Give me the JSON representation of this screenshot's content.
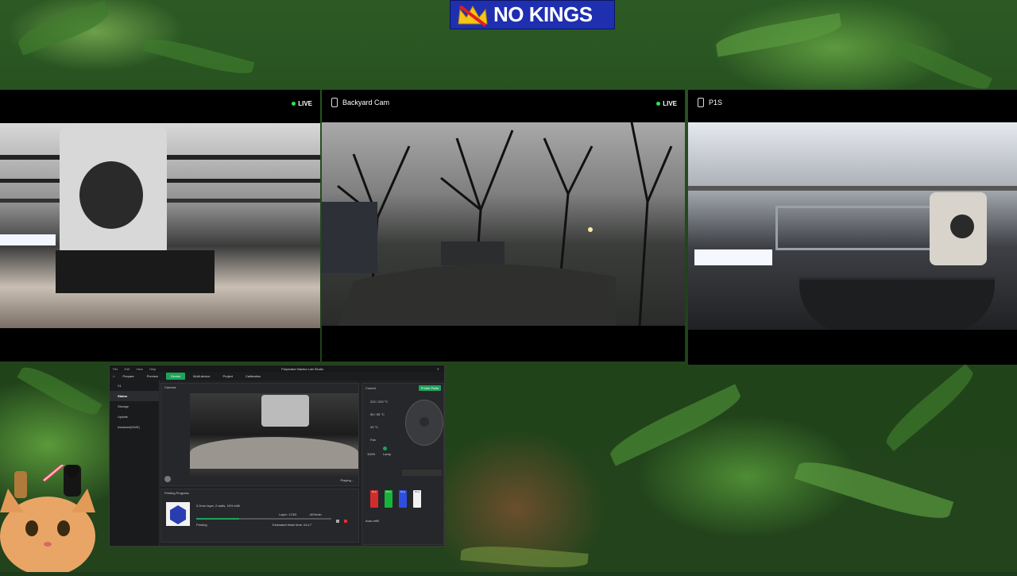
{
  "banner": {
    "text": "NO KINGS",
    "brand_color": "#1e2fb0"
  },
  "cameras": [
    {
      "label": "",
      "live": "LIVE"
    },
    {
      "label": "Backyard Cam",
      "live": "LIVE"
    },
    {
      "label": "P1S",
      "live": ""
    }
  ],
  "app": {
    "menu": [
      "File",
      "Edit",
      "View",
      "Help"
    ],
    "title": "Polymaker Bambu Lab Studio",
    "tabs": [
      "Prepare",
      "Preview",
      "Device",
      "Multi-device",
      "Project",
      "Calibration"
    ],
    "active_tab": "Device",
    "device_name": "X1",
    "sidebar": [
      "Status",
      "Storage",
      "Update",
      "Assistant(HMS)"
    ],
    "camera_tab": "Camera",
    "playing": "Playing...",
    "printing_progress_title": "Printing Progress",
    "job_name": "0.2mm layer, 2 walls, 15% infill",
    "layer": "Layer: 17/63",
    "percent": "-60%min",
    "status": "Printing",
    "finish": "Estimated finish time: 04:17",
    "control": {
      "title": "Control",
      "printer_parts_button": "Printer Parts",
      "nozzle_temp": "220 / 220 °C",
      "bed_temp": "55 / 55 °C",
      "chamber_temp": "33 °C",
      "fan_label": "Fan",
      "fan_value": "100%",
      "lamp_label": "Lamp",
      "spools": [
        {
          "label": "PLA",
          "color": "#d22b2b"
        },
        {
          "label": "PLA",
          "color": "#18b43a"
        },
        {
          "label": "PLA",
          "color": "#2d4fe0"
        },
        {
          "label": "PLA",
          "color": "#f2f2f2"
        }
      ],
      "auto_refill": "Auto-refill"
    }
  }
}
